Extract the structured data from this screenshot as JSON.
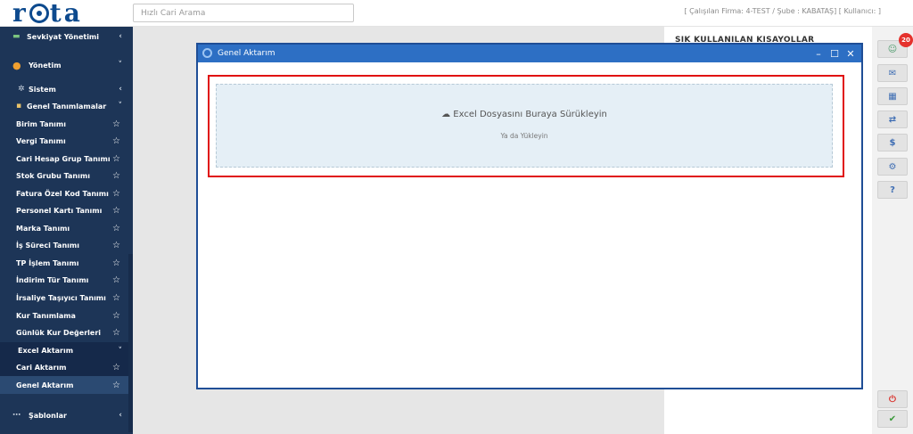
{
  "header": {
    "logo_text": "rota",
    "search_placeholder": "Hızlı Cari Arama",
    "firm_info": "[ Çalışılan Firma: 4-TEST / Şube : KABATAŞ] [ Kullanıcı:                ]"
  },
  "sidebar": {
    "items": [
      {
        "label": "Sevkiyat Yönetimi",
        "type": "parent"
      },
      {
        "label": "Yönetim",
        "type": "parent-open"
      },
      {
        "label": "Sistem",
        "type": "sub"
      },
      {
        "label": "Genel Tanımlamalar",
        "type": "sub-open"
      },
      {
        "label": "Birim Tanımı",
        "type": "leaf"
      },
      {
        "label": "Vergi Tanımı",
        "type": "leaf"
      },
      {
        "label": "Cari Hesap Grup Tanımı",
        "type": "leaf"
      },
      {
        "label": "Stok Grubu Tanımı",
        "type": "leaf"
      },
      {
        "label": "Fatura Özel Kod Tanımı",
        "type": "leaf"
      },
      {
        "label": "Personel Kartı Tanımı",
        "type": "leaf"
      },
      {
        "label": "Marka Tanımı",
        "type": "leaf"
      },
      {
        "label": "İş Süreci Tanımı",
        "type": "leaf"
      },
      {
        "label": "TP İşlem Tanımı",
        "type": "leaf"
      },
      {
        "label": "İndirim Tür Tanımı",
        "type": "leaf"
      },
      {
        "label": "İrsaliye Taşıyıcı Tanımı",
        "type": "leaf"
      },
      {
        "label": "Kur Tanımlama",
        "type": "leaf"
      },
      {
        "label": "Günlük Kur Değerleri",
        "type": "leaf"
      },
      {
        "label": "Excel Aktarım",
        "type": "section"
      },
      {
        "label": "Cari Aktarım",
        "type": "leaf"
      },
      {
        "label": "Genel Aktarım",
        "type": "leaf-active"
      },
      {
        "label": "Şablonlar",
        "type": "parent"
      }
    ]
  },
  "shortcuts": {
    "title": "SIK KULLANILAN KISAYOLLAR"
  },
  "right_toolbar": {
    "badge_count": "20",
    "buttons": [
      "user-icon",
      "mail-icon",
      "calendar-icon",
      "exchange-icon",
      "dollar-icon",
      "settings-icon",
      "help-icon",
      "power-icon",
      "check-icon"
    ]
  },
  "modal": {
    "title": "Genel Aktarım",
    "dropzone_main": "Excel Dosyasını Buraya Sürükleyin",
    "dropzone_sub": "Ya da Yükleyin"
  },
  "colors": {
    "sidebar_bg": "#1d3557",
    "modal_header": "#2d6fc4",
    "highlight_border": "#e01010",
    "dropzone_bg": "#e5eff6"
  }
}
